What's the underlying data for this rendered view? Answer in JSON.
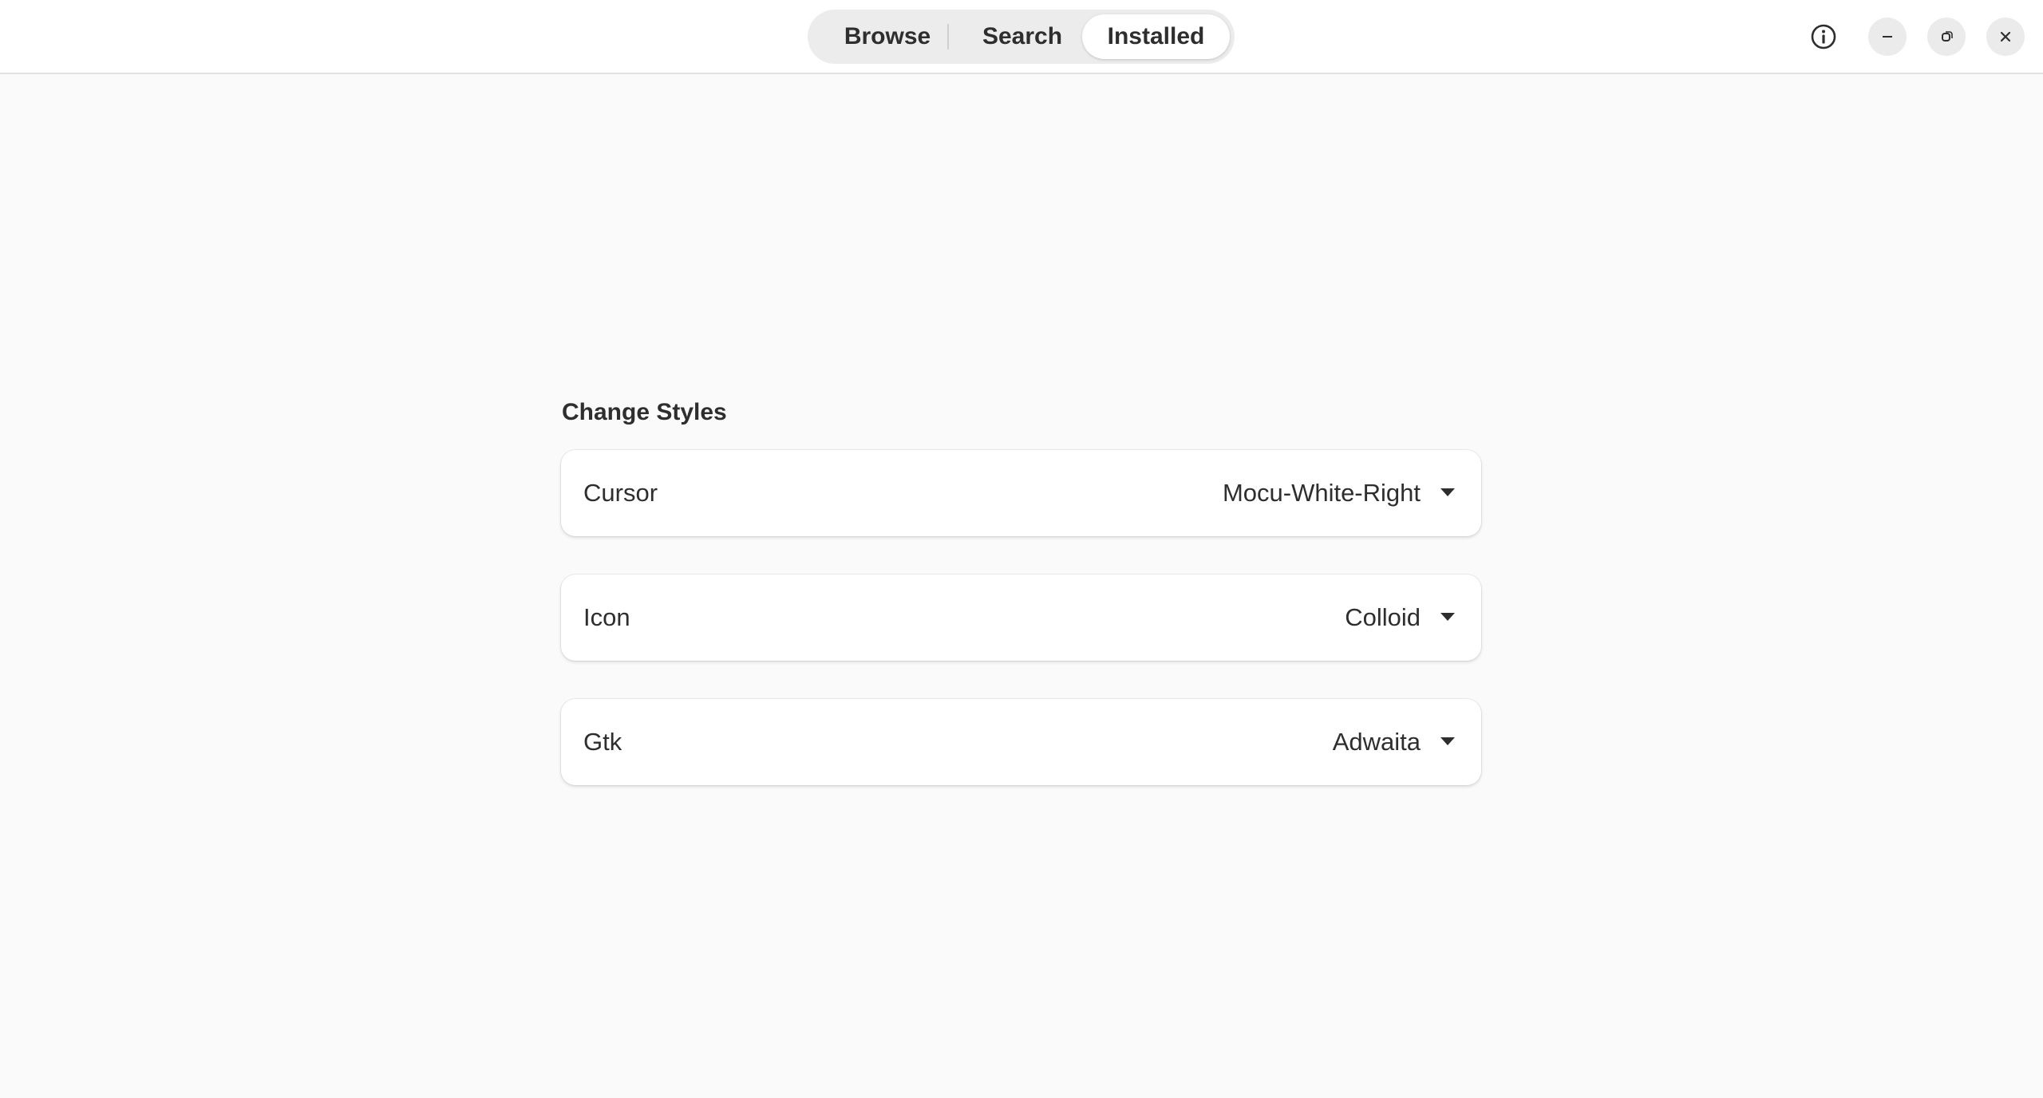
{
  "header": {
    "tabs": [
      {
        "label": "Browse"
      },
      {
        "label": "Search"
      },
      {
        "label": "Installed"
      }
    ],
    "active_tab": "Installed",
    "window_controls": [
      "info-icon",
      "minimize-icon",
      "maximize-icon",
      "close-icon"
    ]
  },
  "main": {
    "section_title": "Change Styles",
    "rows": [
      {
        "label": "Cursor",
        "value": "Mocu-White-Right"
      },
      {
        "label": "Icon",
        "value": "Colloid"
      },
      {
        "label": "Gtk",
        "value": "Adwaita"
      }
    ]
  },
  "colors": {
    "background": "#fafafa",
    "header_bg": "#ffffff",
    "switcher_bg": "#ececec",
    "text": "#2e2e2e"
  }
}
